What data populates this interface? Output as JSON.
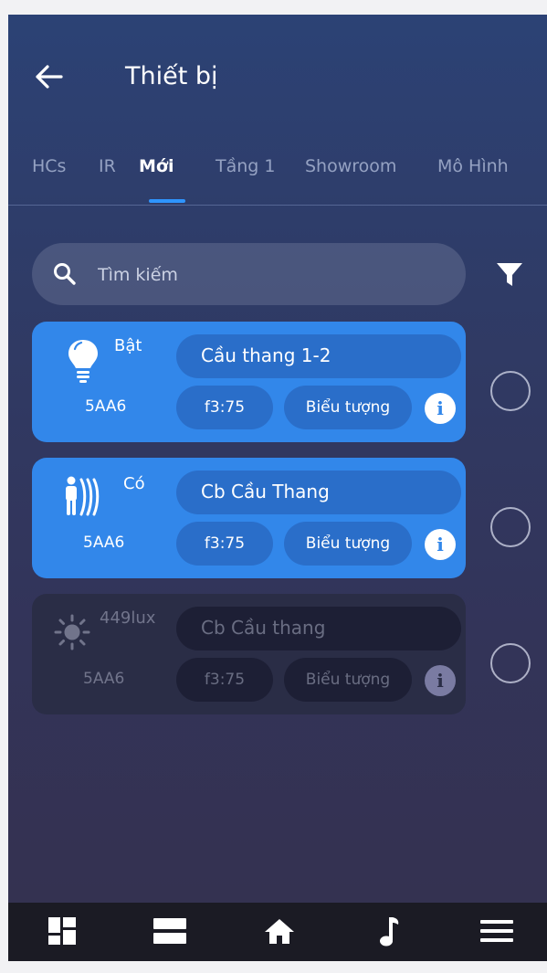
{
  "header": {
    "title": "Thiết bị",
    "back_icon": "arrow-left-icon"
  },
  "tabs": [
    {
      "label": "HCs",
      "active": false
    },
    {
      "label": "IR",
      "active": false
    },
    {
      "label": "Mới",
      "active": true
    },
    {
      "label": "Tầng 1",
      "active": false
    },
    {
      "label": "Showroom",
      "active": false
    },
    {
      "label": "Mô Hình",
      "active": false
    }
  ],
  "search": {
    "placeholder": "Tìm kiếm",
    "value": "",
    "icon": "search-icon"
  },
  "filter": {
    "icon": "filter-icon"
  },
  "devices": [
    {
      "icon": "lightbulb-icon",
      "state": "Bật",
      "id": "5AA6",
      "name": "Cầu thang 1-2",
      "address": "f3:75",
      "icon_label": "Biểu tượng",
      "active": true,
      "selected": false
    },
    {
      "icon": "motion-sensor-icon",
      "state": "Có",
      "id": "5AA6",
      "name": "Cb Cầu Thang",
      "address": "f3:75",
      "icon_label": "Biểu tượng",
      "active": true,
      "selected": false
    },
    {
      "icon": "sun-icon",
      "state": "449lux",
      "id": "5AA6",
      "name": "Cb Cầu thang",
      "address": "f3:75",
      "icon_label": "Biểu tượng",
      "active": false,
      "selected": false
    }
  ],
  "bottom_nav": [
    {
      "icon": "dashboard-icon"
    },
    {
      "icon": "rooms-icon"
    },
    {
      "icon": "home-icon"
    },
    {
      "icon": "music-icon"
    },
    {
      "icon": "menu-icon"
    }
  ],
  "colors": {
    "accent": "#2e95ff",
    "card_active": "#3287ea",
    "card_inactive": "#2a2d46",
    "nav_bar": "#1b1b24"
  }
}
